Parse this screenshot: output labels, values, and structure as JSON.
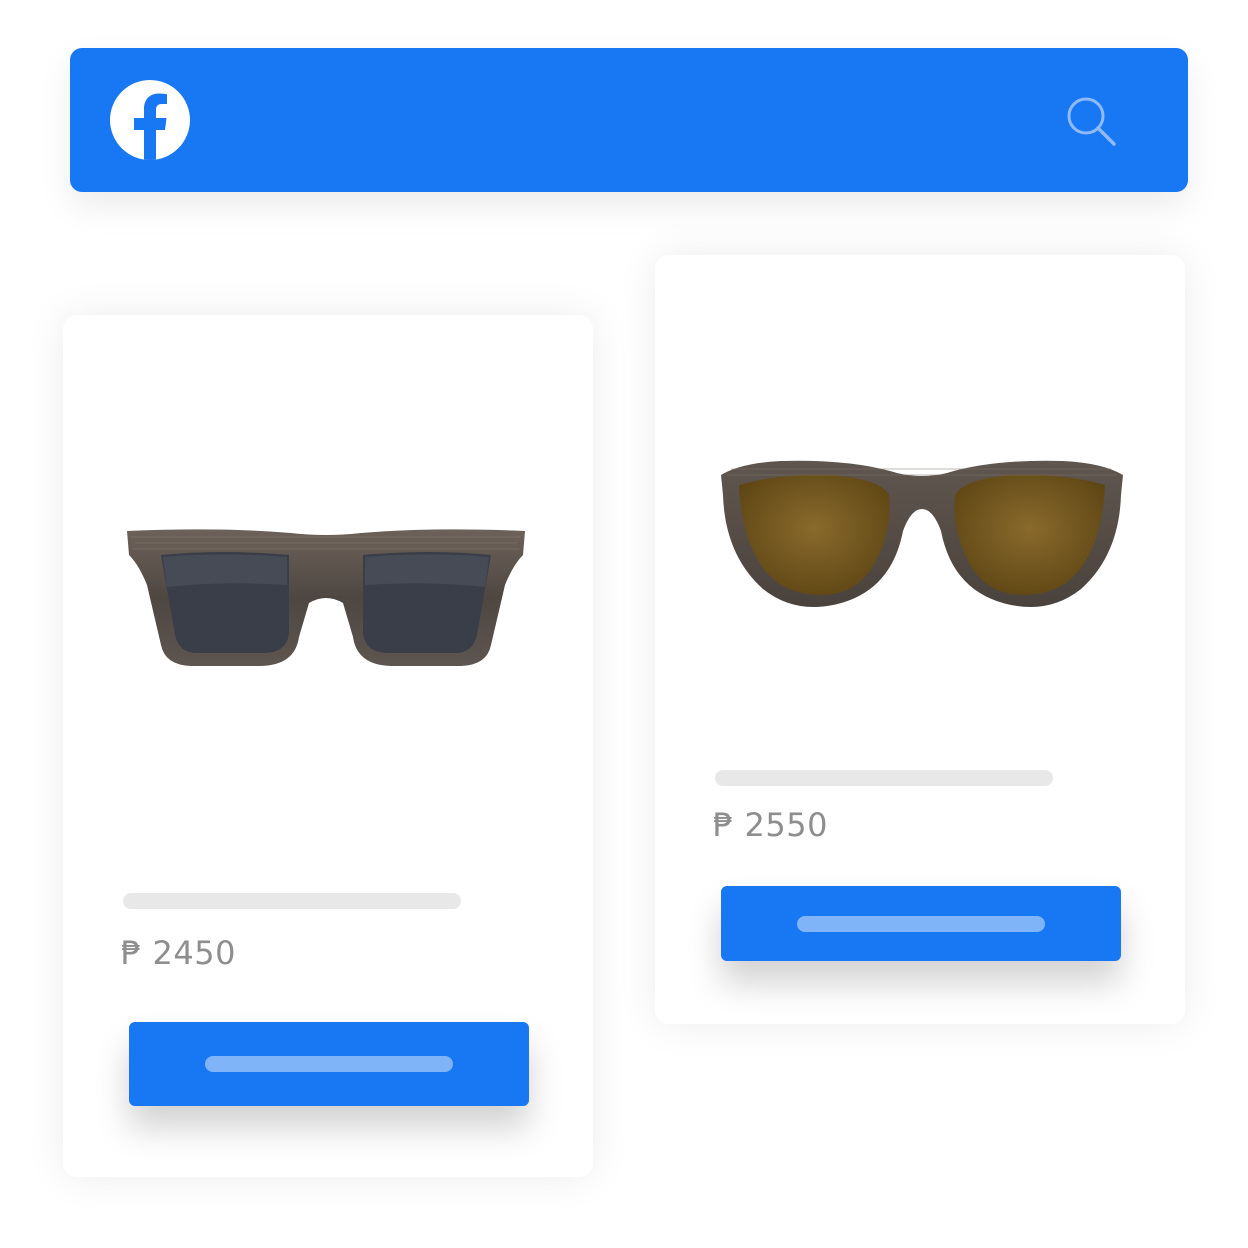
{
  "colors": {
    "brand": "#1877F2",
    "title_placeholder": "#E8E8E8",
    "price_text": "#8E8E8E"
  },
  "header": {
    "logo_icon": "facebook-logo-icon",
    "search_icon": "search-icon"
  },
  "products": [
    {
      "price": "₱ 2450",
      "image": "rectangular-wood-sunglasses-gray-lenses"
    },
    {
      "price": "₱ 2550",
      "image": "round-wood-sunglasses-brown-lenses"
    }
  ]
}
